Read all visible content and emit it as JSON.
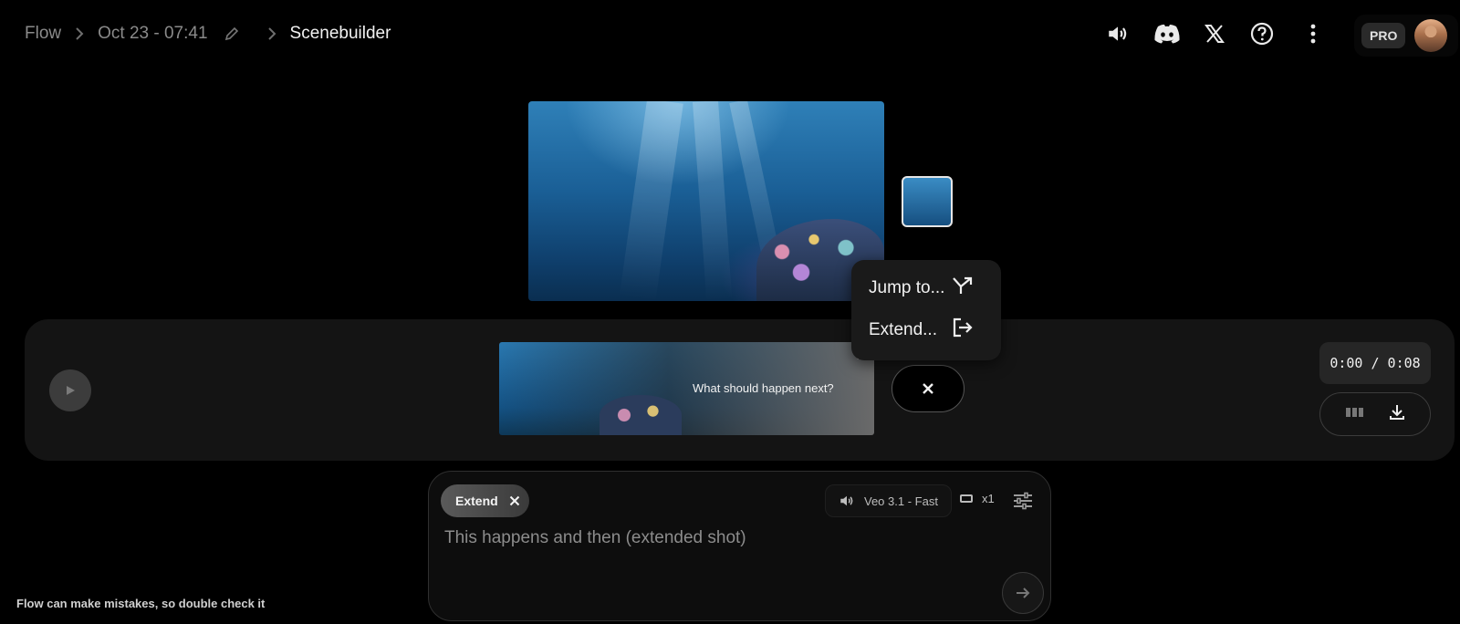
{
  "breadcrumb": {
    "root": "Flow",
    "project": "Oct 23 - 07:41",
    "current": "Scenebuilder"
  },
  "header": {
    "icons": [
      "volume-icon",
      "discord-icon",
      "x-logo-icon",
      "help-icon",
      "more-vert-icon"
    ],
    "plan_badge": "PRO"
  },
  "preview": {
    "thumbnail_count": 1
  },
  "timeline": {
    "clip_prompt": "What should happen next?",
    "timecode": "0:00 / 0:08"
  },
  "context_menu": {
    "items": [
      {
        "label": "Jump to...",
        "icon": "jump-icon"
      },
      {
        "label": "Extend...",
        "icon": "extend-exit-icon"
      }
    ]
  },
  "composer": {
    "mode_chip": "Extend",
    "model": "Veo 3.1 - Fast",
    "count": "x1",
    "placeholder": "This happens and then (extended shot)"
  },
  "footer": {
    "disclaimer": "Flow can make mistakes, so double check it"
  },
  "colors": {
    "background": "#000000",
    "panel": "#141414",
    "menu": "#1a1a1a",
    "text": "#e8e8e8",
    "muted": "#8a8a8a"
  }
}
